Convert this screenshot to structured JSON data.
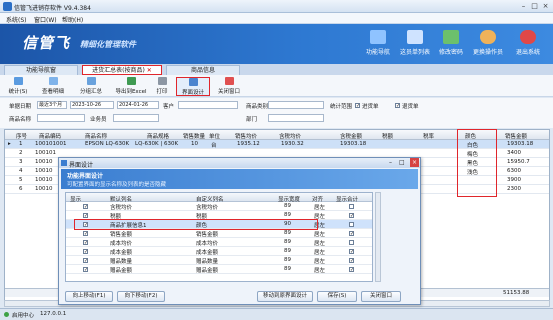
{
  "window": {
    "title": "信管飞进销存软件 V9.4.384"
  },
  "menu": [
    "系统(S)",
    "窗口(W)",
    "帮助(H)"
  ],
  "banner": {
    "brand": "信管飞",
    "subtitle": "精细化管理软件",
    "buttons": [
      "功能导航",
      "这员单列表",
      "修改密码",
      "更换操作员",
      "退出系统"
    ]
  },
  "tabs": [
    "功能导航窗",
    "进货汇总表(按商品)",
    "商品信息"
  ],
  "toolbar": [
    "统计(S)",
    "查看明细",
    "分组汇总",
    "导出到Excel",
    "打印",
    "界面设计",
    "关闭窗口"
  ],
  "filter": {
    "date_label": "单据日期",
    "date_range": "最近3个月",
    "date_from": "2023-10-26",
    "date_to": "2024-01-26",
    "customer_label": "客户",
    "category_label": "商品类别",
    "stats_range_label": "统计范围",
    "purchase_label": "进货单",
    "return_label": "退货单",
    "product_name_label": "商品名称",
    "salesperson_label": "业务员",
    "dept_label": "部门"
  },
  "grid": {
    "headers": [
      "序号",
      "商品编码",
      "商品名称",
      "商品规格",
      "销售数量",
      "单位",
      "销售均价",
      "含税均价",
      "含税金额",
      "税额",
      "税率",
      "颜色",
      "销售金额"
    ],
    "rows": [
      {
        "no": "1",
        "code": "100101001",
        "name": "EPSON LQ-630K",
        "spec": "LQ-630K | 630K",
        "qty": "10",
        "unit": "台",
        "price": "1935.12",
        "taxprice": "1930.32",
        "amount": "19303.18",
        "color": "白色",
        "total": "19303.18"
      },
      {
        "no": "2",
        "code": "100101",
        "name": "",
        "spec": "",
        "qty": "",
        "unit": "",
        "price": "",
        "taxprice": "",
        "amount": "",
        "color": "梅色",
        "total": "3400"
      },
      {
        "no": "3",
        "code": "10010",
        "name": "",
        "spec": "",
        "qty": "",
        "unit": "",
        "price": "",
        "taxprice": "",
        "amount": "",
        "color": "黑色",
        "total": "15950.7"
      },
      {
        "no": "4",
        "code": "10010",
        "name": "",
        "spec": "",
        "qty": "",
        "unit": "",
        "price": "",
        "taxprice": "",
        "amount": "",
        "color": "浅色",
        "total": "6300"
      },
      {
        "no": "5",
        "code": "10010",
        "name": "",
        "spec": "",
        "qty": "",
        "unit": "",
        "price": "",
        "taxprice": "",
        "amount": "",
        "color": "",
        "total": "3900"
      },
      {
        "no": "6",
        "code": "10010",
        "name": "",
        "spec": "",
        "qty": "",
        "unit": "",
        "price": "",
        "taxprice": "",
        "amount": "",
        "color": "",
        "total": "2300"
      }
    ],
    "footer_qty": "37",
    "footer_total": "51153.88"
  },
  "dialog": {
    "title": "界面设计",
    "heading": "功能界面设计",
    "hint": "可配置界面的显示名称及列表的是否隐藏",
    "headers": [
      "显示",
      "默认列名",
      "自定义列名",
      "显示宽度",
      "对齐",
      "显示合计"
    ],
    "rows": [
      {
        "default": "含税均价",
        "custom": "含税均价",
        "width": "89",
        "align": "居左"
      },
      {
        "default": "税额",
        "custom": "税额",
        "width": "89",
        "align": "居左"
      },
      {
        "default": "商品扩展信息1",
        "custom": "颜色",
        "width": "90",
        "align": "居左"
      },
      {
        "default": "销售金额",
        "custom": "销售金额",
        "width": "89",
        "align": "居左"
      },
      {
        "default": "成本均价",
        "custom": "成本均价",
        "width": "89",
        "align": "居左"
      },
      {
        "default": "成本金额",
        "custom": "成本金额",
        "width": "89",
        "align": "居左"
      },
      {
        "default": "赠品数量",
        "custom": "赠品数量",
        "width": "89",
        "align": "居左"
      },
      {
        "default": "赠品金额",
        "custom": "赠品金额",
        "width": "89",
        "align": "居左"
      }
    ],
    "buttons": {
      "up": "向上移动(F1)",
      "down": "向下移动(F2)",
      "restore": "移动到原界面设计",
      "save": "保存(S)",
      "close": "关闭窗口"
    }
  },
  "status": {
    "left": "启用中心",
    "ip": "127.0.0.1"
  }
}
